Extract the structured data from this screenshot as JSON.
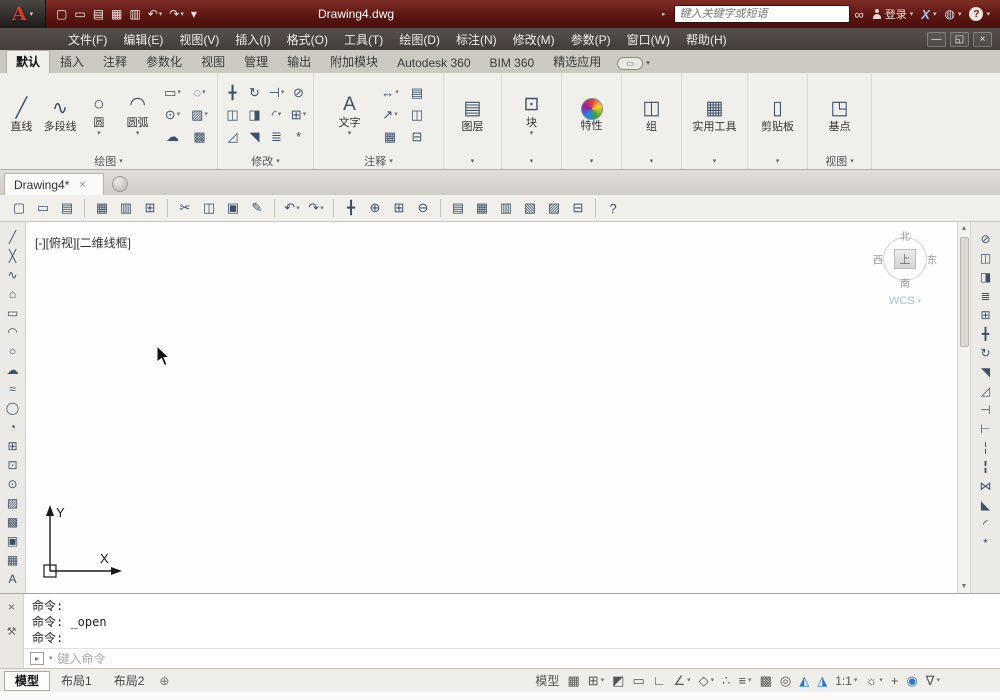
{
  "ui": {
    "chevron": "▾",
    "close": "×",
    "minimize": "—",
    "restore": "◱",
    "arrow_right": "▸",
    "help": "?"
  },
  "titlebar": {
    "logo_letter": "A",
    "title": "Drawing4.dwg",
    "search_placeholder": "键入关键字或短语",
    "binoculars_glyph": "∞",
    "login_label": "登录",
    "exchange_glyph": "X",
    "comm_glyph": "◍",
    "qat": [
      {
        "n": "qat-new-button",
        "g": "▢"
      },
      {
        "n": "qat-open-button",
        "g": "▭"
      },
      {
        "n": "qat-save-button",
        "g": "▤"
      },
      {
        "n": "qat-plot-button",
        "g": "▦"
      },
      {
        "n": "qat-preview-button",
        "g": "▥"
      },
      {
        "n": "qat-undo-button",
        "g": "↶",
        "dd": true
      },
      {
        "n": "qat-redo-button",
        "g": "↷",
        "dd": true
      },
      {
        "n": "qat-customize-button",
        "g": "▾"
      }
    ]
  },
  "menubar": {
    "items": [
      {
        "t": "文件(F)"
      },
      {
        "t": "编辑(E)"
      },
      {
        "t": "视图(V)"
      },
      {
        "t": "插入(I)"
      },
      {
        "t": "格式(O)"
      },
      {
        "t": "工具(T)"
      },
      {
        "t": "绘图(D)"
      },
      {
        "t": "标注(N)"
      },
      {
        "t": "修改(M)"
      },
      {
        "t": "参数(P)"
      },
      {
        "t": "窗口(W)"
      },
      {
        "t": "帮助(H)"
      }
    ]
  },
  "ribbon": {
    "tabs": [
      {
        "t": "默认",
        "active": true
      },
      {
        "t": "插入"
      },
      {
        "t": "注释"
      },
      {
        "t": "参数化"
      },
      {
        "t": "视图"
      },
      {
        "t": "管理"
      },
      {
        "t": "输出"
      },
      {
        "t": "附加模块"
      },
      {
        "t": "Autodesk 360"
      },
      {
        "t": "BIM 360"
      },
      {
        "t": "精选应用"
      }
    ],
    "toggle_glyph": "▭",
    "draw_big": [
      {
        "n": "line-button",
        "t": "直线",
        "g": "╱"
      },
      {
        "n": "polyline-button",
        "t": "多段线",
        "g": "∿"
      },
      {
        "n": "circle-button",
        "t": "圆",
        "g": "○",
        "dd": true
      },
      {
        "n": "arc-button",
        "t": "圆弧",
        "g": "◠",
        "dd": true
      }
    ],
    "draw_grid": [
      {
        "n": "rectangle-button",
        "g": "▭",
        "dd": true
      },
      {
        "n": "ellipse-button",
        "g": "◌",
        "dd": true
      },
      {
        "n": "point-button",
        "g": "⊙",
        "dd": true
      },
      {
        "n": "hatch-button",
        "g": "▨",
        "dd": true
      },
      {
        "n": "revision-cloud-button",
        "g": "☁"
      },
      {
        "n": "gradient-button",
        "g": "▩"
      }
    ],
    "modify_grid": [
      {
        "n": "move-button",
        "g": "╋"
      },
      {
        "n": "rotate-button",
        "g": "↻"
      },
      {
        "n": "trim-button",
        "g": "⊣",
        "dd": true
      },
      {
        "n": "erase-button",
        "g": "⊘"
      },
      {
        "n": "copy-button",
        "g": "◫"
      },
      {
        "n": "mirror-button",
        "g": "◨"
      },
      {
        "n": "fillet-button",
        "g": "◜",
        "dd": true
      },
      {
        "n": "array-button",
        "g": "⊞",
        "dd": true
      },
      {
        "n": "stretch-button",
        "g": "◿"
      },
      {
        "n": "scale-button",
        "g": "◥"
      },
      {
        "n": "offset-button",
        "g": "≣"
      },
      {
        "n": "explode-button",
        "g": "*"
      }
    ],
    "annotation_grid": [
      {
        "n": "linear-dimension-button",
        "g": "↔",
        "dd": true
      },
      {
        "n": "dimension-style-button",
        "g": "▤"
      },
      {
        "n": "multileader-button",
        "g": "↗",
        "dd": true
      },
      {
        "n": "multileader-style-button",
        "g": "◫"
      },
      {
        "n": "table-button",
        "g": "▦"
      },
      {
        "n": "table-style-button",
        "g": "⊟"
      }
    ],
    "singles": {
      "text": {
        "t": "文字",
        "g": "A"
      },
      "layers": {
        "t": "图层",
        "g": "▤"
      },
      "block": {
        "t": "块",
        "g": "⊡"
      },
      "properties": {
        "t": "特性"
      },
      "group": {
        "t": "组",
        "g": "◫"
      },
      "utilities": {
        "t": "实用工具",
        "g": "▦"
      },
      "clipboard": {
        "t": "剪贴板",
        "g": "▯"
      },
      "base": {
        "t": "基点",
        "g": "◳"
      }
    },
    "panel_labels": {
      "draw": "绘图",
      "modify": "修改",
      "annotation": "注释",
      "view": "视图"
    }
  },
  "doctabs": {
    "active_tab": "Drawing4*"
  },
  "toolbar": {
    "items": [
      {
        "n": "new-button",
        "g": "▢"
      },
      {
        "n": "open-button",
        "g": "▭"
      },
      {
        "n": "save-button",
        "g": "▤"
      },
      {
        "sep": true
      },
      {
        "n": "plot-button",
        "g": "▦"
      },
      {
        "n": "plot-preview-button",
        "g": "▥"
      },
      {
        "n": "publish-button",
        "g": "⊞"
      },
      {
        "sep": true
      },
      {
        "n": "cut-button",
        "g": "✂"
      },
      {
        "n": "copy-clip-button",
        "g": "◫"
      },
      {
        "n": "paste-button",
        "g": "▣"
      },
      {
        "n": "match-properties-button",
        "g": "✎"
      },
      {
        "sep": true
      },
      {
        "n": "undo-button",
        "g": "↶",
        "dd": true
      },
      {
        "n": "redo-button",
        "g": "↷",
        "dd": true
      },
      {
        "sep": true
      },
      {
        "n": "pan-button",
        "g": "╋"
      },
      {
        "n": "zoom-realtime-button",
        "g": "⊕"
      },
      {
        "n": "zoom-window-button",
        "g": "⊞"
      },
      {
        "n": "zoom-previous-button",
        "g": "⊖"
      },
      {
        "sep": true
      },
      {
        "n": "properties-palette-button",
        "g": "▤"
      },
      {
        "n": "design-center-button",
        "g": "▦"
      },
      {
        "n": "tool-palettes-button",
        "g": "▥"
      },
      {
        "n": "sheet-set-manager-button",
        "g": "▧"
      },
      {
        "n": "markup-set-manager-button",
        "g": "▨"
      },
      {
        "n": "quick-calc-button",
        "g": "⊟"
      },
      {
        "sep": true
      },
      {
        "n": "help-button",
        "g": "?"
      }
    ]
  },
  "left_toolbar": [
    {
      "n": "line-tool",
      "g": "╱"
    },
    {
      "n": "construction-line-tool",
      "g": "╳"
    },
    {
      "n": "polyline-tool",
      "g": "∿"
    },
    {
      "n": "polygon-tool",
      "g": "⌂"
    },
    {
      "n": "rectangle-tool",
      "g": "▭"
    },
    {
      "n": "arc-tool",
      "g": "◠"
    },
    {
      "n": "circle-tool",
      "g": "○"
    },
    {
      "n": "revision-cloud-tool",
      "g": "☁"
    },
    {
      "n": "spline-tool",
      "g": "≈"
    },
    {
      "n": "ellipse-tool",
      "g": "◯"
    },
    {
      "n": "ellipse-arc-tool",
      "g": "◔"
    },
    {
      "n": "insert-block-tool",
      "g": "⊞"
    },
    {
      "n": "make-block-tool",
      "g": "⊡"
    },
    {
      "n": "point-tool",
      "g": "⊙"
    },
    {
      "n": "hatch-tool",
      "g": "▨"
    },
    {
      "n": "gradient-tool",
      "g": "▩"
    },
    {
      "n": "region-tool",
      "g": "▣"
    },
    {
      "n": "table-tool",
      "g": "▦"
    },
    {
      "n": "multiline-text-tool",
      "g": "A"
    }
  ],
  "right_toolbar": [
    {
      "n": "erase-tool",
      "g": "⊘"
    },
    {
      "n": "copy-tool",
      "g": "◫"
    },
    {
      "n": "mirror-tool",
      "g": "◨"
    },
    {
      "n": "offset-tool",
      "g": "≣"
    },
    {
      "n": "array-tool",
      "g": "⊞"
    },
    {
      "n": "move-tool",
      "g": "╋"
    },
    {
      "n": "rotate-tool",
      "g": "↻"
    },
    {
      "n": "scale-tool",
      "g": "◥"
    },
    {
      "n": "stretch-tool",
      "g": "◿"
    },
    {
      "n": "trim-tool",
      "g": "⊣"
    },
    {
      "n": "extend-tool",
      "g": "⊢"
    },
    {
      "n": "break-at-point-tool",
      "g": "╎"
    },
    {
      "n": "break-tool",
      "g": "╏"
    },
    {
      "n": "join-tool",
      "g": "⋈"
    },
    {
      "n": "chamfer-tool",
      "g": "◣"
    },
    {
      "n": "fillet-tool",
      "g": "◜"
    },
    {
      "n": "explode-tool",
      "g": "*"
    }
  ],
  "canvas": {
    "viewport_label": "[-][俯视][二维线框]",
    "viewcube": {
      "north": "北",
      "south": "南",
      "west": "西",
      "east": "东",
      "top": "上",
      "wcs": "WCS"
    },
    "ucs": {
      "x_label": "X",
      "y_label": "Y"
    }
  },
  "command": {
    "lines": [
      "命令:",
      "命令: _open",
      "命令:"
    ],
    "input_placeholder": "键入命令",
    "wrench_glyph": "⚒",
    "prompt_glyph": "▸"
  },
  "statusbar": {
    "layout_tabs": [
      {
        "n": "model-tab",
        "t": "模型",
        "active": true
      },
      {
        "n": "layout1-tab",
        "t": "布局1"
      },
      {
        "n": "layout2-tab",
        "t": "布局2"
      }
    ],
    "new_layout_glyph": "⊕",
    "right_items": [
      {
        "n": "model-space-button",
        "t": "模型"
      },
      {
        "n": "grid-display-toggle",
        "g": "▦"
      },
      {
        "n": "snap-mode-toggle",
        "g": "⊞",
        "dd": true
      },
      {
        "n": "infer-constraints-toggle",
        "g": "◩"
      },
      {
        "n": "dynamic-input-toggle",
        "g": "▭"
      },
      {
        "n": "ortho-mode-toggle",
        "g": "∟"
      },
      {
        "n": "polar-tracking-toggle",
        "g": "∠",
        "dd": true
      },
      {
        "n": "object-snap-toggle",
        "g": "◇",
        "dd": true
      },
      {
        "n": "object-snap-tracking-toggle",
        "g": "∴"
      },
      {
        "n": "lineweight-display-toggle",
        "g": "≡",
        "dd": true
      },
      {
        "n": "transparency-toggle",
        "g": "▩"
      },
      {
        "n": "selection-cycling-toggle",
        "g": "◎"
      },
      {
        "n": "annotation-visibility-toggle",
        "g": "◭",
        "c": "blue"
      },
      {
        "n": "annotation-autoscale-toggle",
        "g": "◮",
        "c": "blue"
      },
      {
        "n": "annotation-scale-button",
        "t": "1:1",
        "dd": true
      },
      {
        "n": "workspace-switching-button",
        "g": "☼",
        "dd": true
      },
      {
        "n": "annotation-monitor-button",
        "g": "+"
      },
      {
        "n": "isolate-objects-button",
        "g": "◉",
        "c": "blue"
      },
      {
        "n": "filter-button",
        "g": "∇",
        "dd": true
      }
    ]
  }
}
